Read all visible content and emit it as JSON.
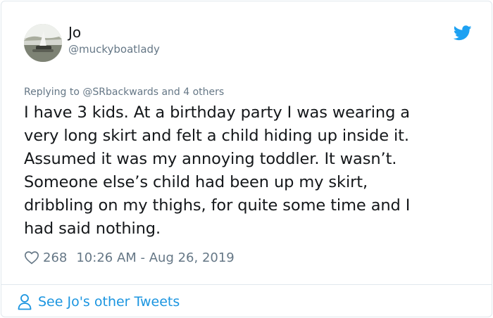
{
  "tweet": {
    "author_name": "Jo",
    "author_handle": "@muckyboatlady",
    "reply_prefix": "Replying to ",
    "reply_targets": "@SRbackwards and 4 others",
    "text": "I have 3 kids. At a birthday party I was wearing a\nvery long skirt and felt a child hiding up inside it.\nAssumed it was my annoying toddler. It wasn’t.\nSomeone else’s child had been up my skirt,\ndribbling on my thighs, for quite some time and I\nhad said nothing.",
    "like_count": "268",
    "timestamp": "10:26 AM - Aug 26, 2019"
  },
  "footer": {
    "label": "See Jo's other Tweets"
  },
  "icons": {
    "logo": "twitter-bird-icon",
    "like": "heart-icon",
    "profile": "person-icon"
  },
  "colors": {
    "brand": "#1da1f2",
    "link": "#1b95e0",
    "secondary_text": "#657786",
    "border": "#e1e8ed"
  }
}
